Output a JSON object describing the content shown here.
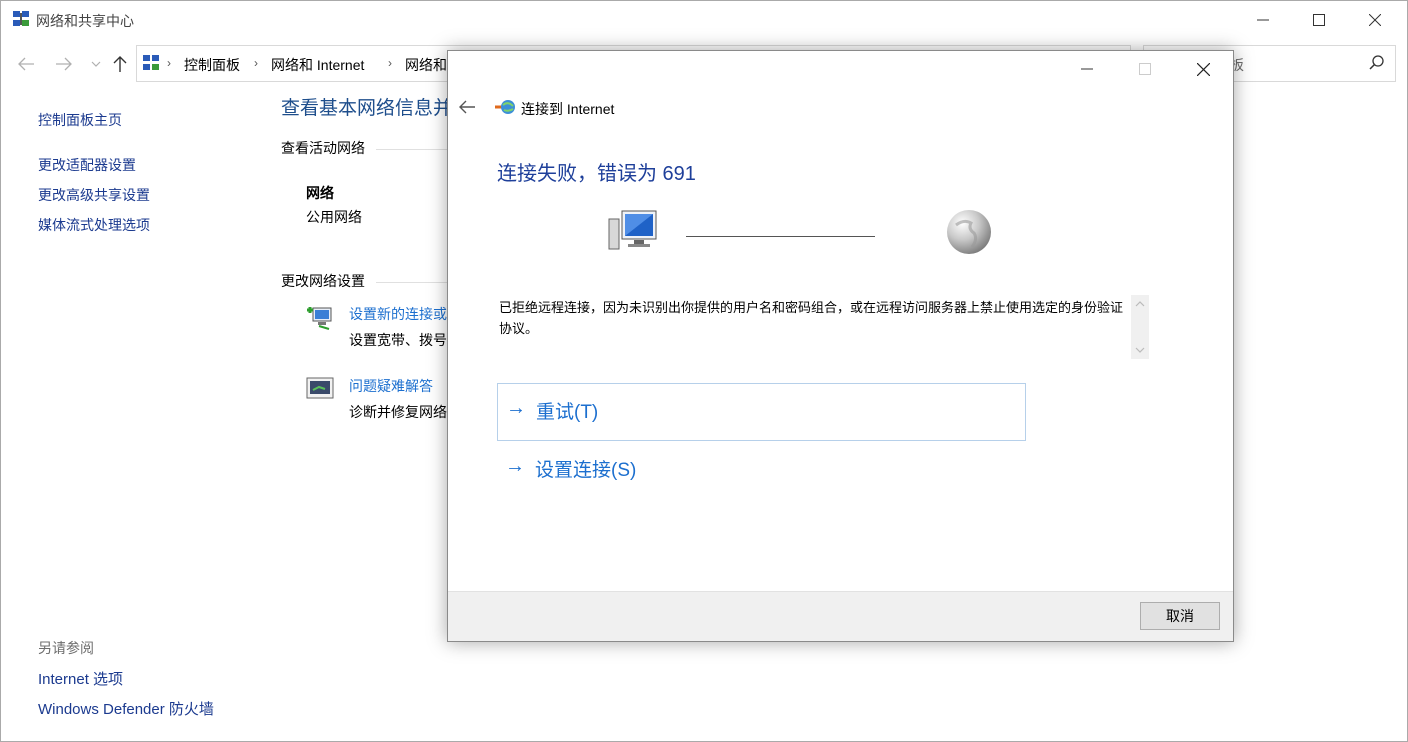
{
  "window": {
    "title": "网络和共享中心",
    "icon": "network-center-icon"
  },
  "address": {
    "crumbs": [
      "控制面板",
      "网络和 Internet",
      "网络和"
    ],
    "search_fragment": "板"
  },
  "left_pane": {
    "links": [
      "控制面板主页",
      "更改适配器设置",
      "更改高级共享设置",
      "媒体流式处理选项"
    ],
    "see_also_label": "另请参阅",
    "see_also_links": [
      "Internet 选项",
      "Windows Defender 防火墙"
    ]
  },
  "main": {
    "title": "查看基本网络信息并",
    "active_networks_label": "查看活动网络",
    "network_name": "网络",
    "network_type": "公用网络",
    "change_settings_label": "更改网络设置",
    "tasks": [
      {
        "link": "设置新的连接或",
        "desc": "设置宽带、拨号",
        "icon": "new-connection-icon"
      },
      {
        "link": "问题疑难解答",
        "desc": "诊断并修复网络",
        "icon": "troubleshoot-icon"
      }
    ]
  },
  "dialog": {
    "title": "连接到 Internet",
    "heading": "连接失败，错误为 691",
    "message": "已拒绝远程连接，因为未识别出你提供的用户名和密码组合，或在远程访问服务器上禁止使用选定的身份验证协议。",
    "commands": [
      {
        "arrow": "→",
        "label": "重试(T)"
      },
      {
        "arrow": "→",
        "label": "设置连接(S)"
      }
    ],
    "cancel_label": "取消"
  },
  "colors": {
    "link": "#1b3a8f",
    "accent": "#1c6fcf",
    "heading": "#1e3f9a"
  }
}
